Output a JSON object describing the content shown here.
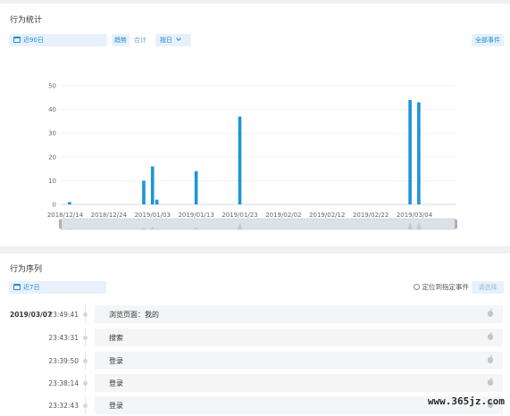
{
  "stats": {
    "title": "行为统计",
    "date_range": "近90日",
    "tab_trend": "趋势",
    "tab_total": "合计",
    "granularity": "按日",
    "all_events": "全部事件"
  },
  "chart_data": {
    "type": "bar",
    "x_tick_labels": [
      "2018/12/14",
      "2018/12/24",
      "2019/01/03",
      "2019/01/13",
      "2019/01/23",
      "2019/02/02",
      "2019/02/12",
      "2019/02/22",
      "2019/03/04"
    ],
    "y_ticks": [
      0,
      10,
      20,
      30,
      40,
      50
    ],
    "ylim": [
      0,
      50
    ],
    "grid": true,
    "bar_color": "#1a96d8",
    "points": [
      {
        "date": "2018/12/15",
        "value": 1
      },
      {
        "date": "2019/01/01",
        "value": 10
      },
      {
        "date": "2019/01/03",
        "value": 16
      },
      {
        "date": "2019/01/04",
        "value": 2
      },
      {
        "date": "2019/01/13",
        "value": 14
      },
      {
        "date": "2019/01/23",
        "value": 37
      },
      {
        "date": "2019/03/03",
        "value": 44
      },
      {
        "date": "2019/03/05",
        "value": 43
      }
    ]
  },
  "sequence": {
    "title": "行为序列",
    "date_range": "近7日",
    "locate_label": "定位到指定事件",
    "select_placeholder": "请选择",
    "date": "2019/03/07",
    "rows": [
      {
        "time": "23:49:41",
        "event": "浏览页面：我的"
      },
      {
        "time": "23:43:31",
        "event": "搜索"
      },
      {
        "time": "23:39:50",
        "event": "登录"
      },
      {
        "time": "23:38:14",
        "event": "登录"
      },
      {
        "time": "23:32:43",
        "event": "登录"
      }
    ]
  },
  "watermark": "www.365jz.com"
}
